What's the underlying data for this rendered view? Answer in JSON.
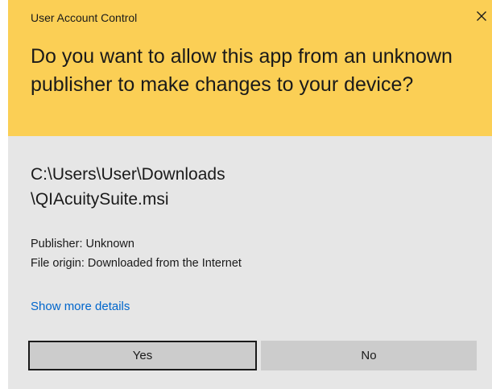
{
  "window": {
    "title": "User Account Control",
    "close_icon": "close-icon"
  },
  "header": {
    "question": "Do you want to allow this app from an unknown publisher to make changes to your device?",
    "background_color": "#fbcf55"
  },
  "file": {
    "path_line1": "C:\\Users\\User\\Downloads",
    "path_line2": "\\QIAcuitySuite.msi"
  },
  "details": {
    "publisher": "Publisher: Unknown",
    "file_origin": "File origin: Downloaded from the Internet"
  },
  "links": {
    "show_more": "Show more details",
    "link_color": "#0066cc"
  },
  "buttons": {
    "yes_label": "Yes",
    "no_label": "No"
  }
}
